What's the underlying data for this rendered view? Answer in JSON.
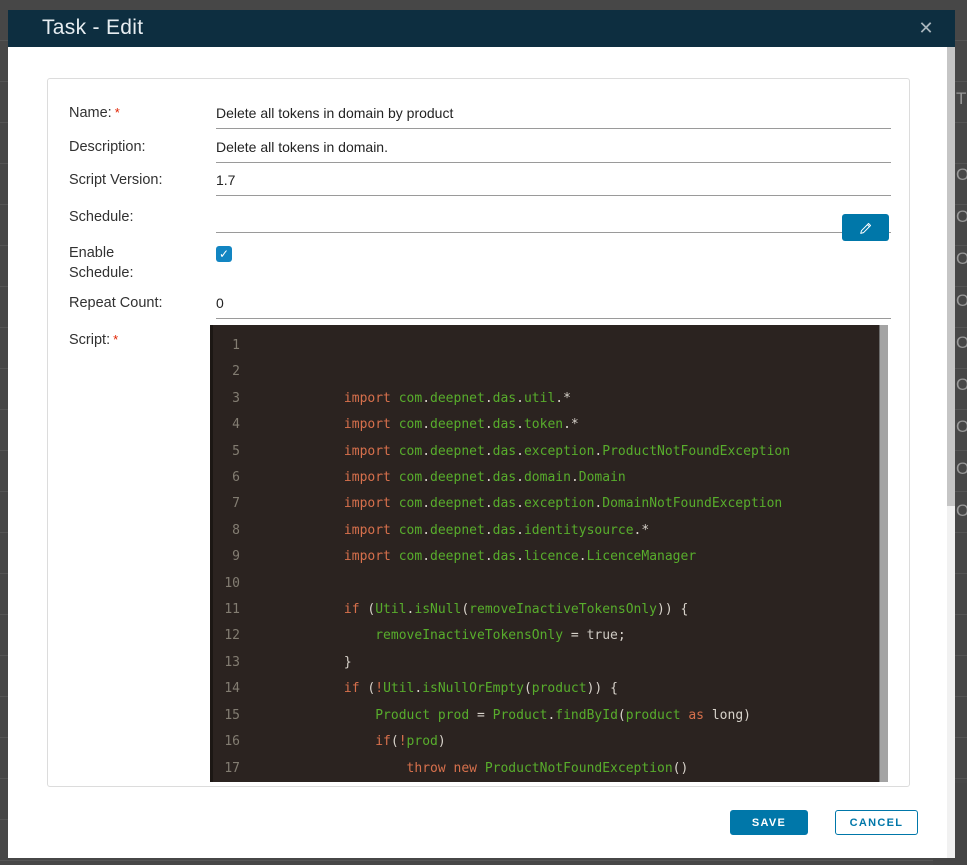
{
  "window": {
    "title": "Task - Edit",
    "close_icon": "✕"
  },
  "colors": {
    "accent": "#0077a9",
    "header_bg": "#0d2e40",
    "editor_bg": "#2b2320",
    "keyword": "#d7704c",
    "identifier": "#58ad2c",
    "punctuation": "#d8d3cb",
    "literal": "#cfcbc4",
    "line_number": "#837d72",
    "required": "#e12200",
    "backdrop": "#474747"
  },
  "form": {
    "required_marker": "*",
    "checkbox_glyph": "✓",
    "fields": [
      {
        "label": "Name:",
        "required": true,
        "value": "Delete all tokens in domain by product"
      },
      {
        "label": "Description:",
        "required": false,
        "value": "Delete all tokens in domain."
      },
      {
        "label": "Script Version:",
        "required": false,
        "value": "1.7"
      },
      {
        "label": "Schedule:",
        "required": false,
        "value": ""
      },
      {
        "label": "Enable Schedule:",
        "required": false,
        "checked": true
      },
      {
        "label": "Repeat Count:",
        "required": false,
        "value": "0"
      },
      {
        "label": "Script:",
        "required": true
      }
    ]
  },
  "editor": {
    "lines": [
      {
        "num": "1",
        "tokens": []
      },
      {
        "num": "2",
        "tokens": []
      },
      {
        "num": "3",
        "tokens": [
          [
            "w",
            "            "
          ],
          [
            "k",
            "import"
          ],
          [
            "w",
            " "
          ],
          [
            "g",
            "com"
          ],
          [
            "p",
            "."
          ],
          [
            "g",
            "deepnet"
          ],
          [
            "p",
            "."
          ],
          [
            "g",
            "das"
          ],
          [
            "p",
            "."
          ],
          [
            "g",
            "util"
          ],
          [
            "p",
            ".*"
          ]
        ]
      },
      {
        "num": "4",
        "tokens": [
          [
            "w",
            "            "
          ],
          [
            "k",
            "import"
          ],
          [
            "w",
            " "
          ],
          [
            "g",
            "com"
          ],
          [
            "p",
            "."
          ],
          [
            "g",
            "deepnet"
          ],
          [
            "p",
            "."
          ],
          [
            "g",
            "das"
          ],
          [
            "p",
            "."
          ],
          [
            "g",
            "token"
          ],
          [
            "p",
            ".*"
          ]
        ]
      },
      {
        "num": "5",
        "tokens": [
          [
            "w",
            "            "
          ],
          [
            "k",
            "import"
          ],
          [
            "w",
            " "
          ],
          [
            "g",
            "com"
          ],
          [
            "p",
            "."
          ],
          [
            "g",
            "deepnet"
          ],
          [
            "p",
            "."
          ],
          [
            "g",
            "das"
          ],
          [
            "p",
            "."
          ],
          [
            "g",
            "exception"
          ],
          [
            "p",
            "."
          ],
          [
            "g",
            "ProductNotFoundException"
          ]
        ]
      },
      {
        "num": "6",
        "tokens": [
          [
            "w",
            "            "
          ],
          [
            "k",
            "import"
          ],
          [
            "w",
            " "
          ],
          [
            "g",
            "com"
          ],
          [
            "p",
            "."
          ],
          [
            "g",
            "deepnet"
          ],
          [
            "p",
            "."
          ],
          [
            "g",
            "das"
          ],
          [
            "p",
            "."
          ],
          [
            "g",
            "domain"
          ],
          [
            "p",
            "."
          ],
          [
            "g",
            "Domain"
          ]
        ]
      },
      {
        "num": "7",
        "tokens": [
          [
            "w",
            "            "
          ],
          [
            "k",
            "import"
          ],
          [
            "w",
            " "
          ],
          [
            "g",
            "com"
          ],
          [
            "p",
            "."
          ],
          [
            "g",
            "deepnet"
          ],
          [
            "p",
            "."
          ],
          [
            "g",
            "das"
          ],
          [
            "p",
            "."
          ],
          [
            "g",
            "exception"
          ],
          [
            "p",
            "."
          ],
          [
            "g",
            "DomainNotFoundException"
          ]
        ]
      },
      {
        "num": "8",
        "tokens": [
          [
            "w",
            "            "
          ],
          [
            "k",
            "import"
          ],
          [
            "w",
            " "
          ],
          [
            "g",
            "com"
          ],
          [
            "p",
            "."
          ],
          [
            "g",
            "deepnet"
          ],
          [
            "p",
            "."
          ],
          [
            "g",
            "das"
          ],
          [
            "p",
            "."
          ],
          [
            "g",
            "identitysource"
          ],
          [
            "p",
            ".*"
          ]
        ]
      },
      {
        "num": "9",
        "tokens": [
          [
            "w",
            "            "
          ],
          [
            "k",
            "import"
          ],
          [
            "w",
            " "
          ],
          [
            "g",
            "com"
          ],
          [
            "p",
            "."
          ],
          [
            "g",
            "deepnet"
          ],
          [
            "p",
            "."
          ],
          [
            "g",
            "das"
          ],
          [
            "p",
            "."
          ],
          [
            "g",
            "licence"
          ],
          [
            "p",
            "."
          ],
          [
            "g",
            "LicenceManager"
          ]
        ]
      },
      {
        "num": "10",
        "tokens": []
      },
      {
        "num": "11",
        "tokens": [
          [
            "w",
            "            "
          ],
          [
            "k",
            "if"
          ],
          [
            "w",
            " "
          ],
          [
            "p",
            "("
          ],
          [
            "g",
            "Util"
          ],
          [
            "p",
            "."
          ],
          [
            "g",
            "isNull"
          ],
          [
            "p",
            "("
          ],
          [
            "g",
            "removeInactiveTokensOnly"
          ],
          [
            "p",
            "))"
          ],
          [
            "w",
            " "
          ],
          [
            "p",
            "{"
          ]
        ]
      },
      {
        "num": "12",
        "tokens": [
          [
            "w",
            "                "
          ],
          [
            "g",
            "removeInactiveTokensOnly"
          ],
          [
            "w",
            " "
          ],
          [
            "p",
            "="
          ],
          [
            "w",
            " "
          ],
          [
            "t",
            "true"
          ],
          [
            "p",
            ";"
          ]
        ]
      },
      {
        "num": "13",
        "tokens": [
          [
            "w",
            "            "
          ],
          [
            "p",
            "}"
          ]
        ]
      },
      {
        "num": "14",
        "tokens": [
          [
            "w",
            "            "
          ],
          [
            "k",
            "if"
          ],
          [
            "w",
            " "
          ],
          [
            "p",
            "("
          ],
          [
            "k",
            "!"
          ],
          [
            "g",
            "Util"
          ],
          [
            "p",
            "."
          ],
          [
            "g",
            "isNullOrEmpty"
          ],
          [
            "p",
            "("
          ],
          [
            "g",
            "product"
          ],
          [
            "p",
            "))"
          ],
          [
            "w",
            " "
          ],
          [
            "p",
            "{"
          ]
        ]
      },
      {
        "num": "15",
        "tokens": [
          [
            "w",
            "                "
          ],
          [
            "g",
            "Product"
          ],
          [
            "w",
            " "
          ],
          [
            "g",
            "prod"
          ],
          [
            "w",
            " "
          ],
          [
            "p",
            "="
          ],
          [
            "w",
            " "
          ],
          [
            "g",
            "Product"
          ],
          [
            "p",
            "."
          ],
          [
            "g",
            "findById"
          ],
          [
            "p",
            "("
          ],
          [
            "g",
            "product"
          ],
          [
            "w",
            " "
          ],
          [
            "k",
            "as"
          ],
          [
            "w",
            " "
          ],
          [
            "p",
            "long)"
          ]
        ]
      },
      {
        "num": "16",
        "tokens": [
          [
            "w",
            "                "
          ],
          [
            "k",
            "if"
          ],
          [
            "p",
            "("
          ],
          [
            "k",
            "!"
          ],
          [
            "g",
            "prod"
          ],
          [
            "p",
            ")"
          ]
        ]
      },
      {
        "num": "17",
        "tokens": [
          [
            "w",
            "                    "
          ],
          [
            "k",
            "throw"
          ],
          [
            "w",
            " "
          ],
          [
            "k",
            "new"
          ],
          [
            "w",
            " "
          ],
          [
            "g",
            "ProductNotFoundException"
          ],
          [
            "p",
            "()"
          ]
        ]
      }
    ]
  },
  "footer": {
    "save_label": "SAVE",
    "cancel_label": "CANCEL"
  },
  "backdrop": {
    "glyphs": [
      "T",
      "O",
      "O",
      "O",
      "O",
      "O",
      "O",
      "O",
      "O",
      "O"
    ]
  }
}
